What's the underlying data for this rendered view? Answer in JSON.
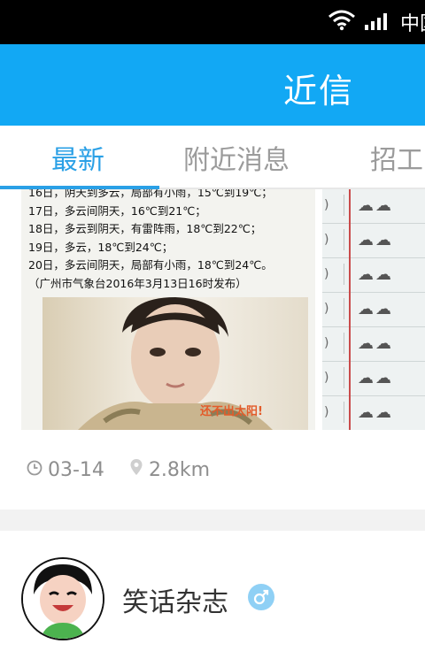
{
  "status_bar": {
    "carrier": "中国"
  },
  "app_bar": {
    "title": "近信"
  },
  "tabs": [
    {
      "label": "最新",
      "active": true
    },
    {
      "label": "附近消息",
      "active": false
    },
    {
      "label": "招工",
      "active": false
    }
  ],
  "post": {
    "weather_lines": [
      "16日，阴天到多云，局部有小雨，15℃到19℃；",
      "17日，多云间阴天，16℃到21℃；",
      "18日，多云到阴天，有雷阵雨，18℃到22℃；",
      "19日，多云，18℃到24℃；",
      "20日，多云间阴天，局部有小雨，18℃到24℃。",
      "（广州市气象台2016年3月13日16时发布）"
    ],
    "photo_caption": "还不出太阳!",
    "date": "03-14",
    "distance": "2.8km"
  },
  "author": {
    "name": "笑话杂志"
  },
  "colors": {
    "accent": "#12a8f4",
    "tab_active": "#2aa0e6",
    "status_bar": "#000000"
  }
}
